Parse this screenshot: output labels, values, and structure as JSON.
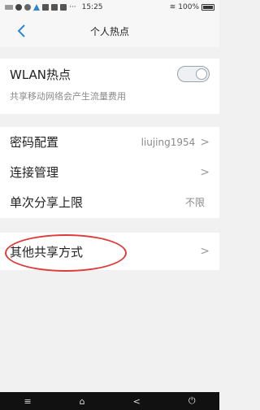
{
  "status_bar": {
    "time": "15:25",
    "more": "···",
    "battery_text": "100%"
  },
  "nav": {
    "back_icon": "chevron-left",
    "title": "个人热点"
  },
  "hotspot": {
    "label": "WLAN热点",
    "toggle_state": "off",
    "description": "共享移动网络会产生流量费用"
  },
  "settings": [
    {
      "label": "密码配置",
      "value": "liujing1954",
      "chevron": ">"
    },
    {
      "label": "连接管理",
      "value": "",
      "chevron": ">"
    },
    {
      "label": "单次分享上限",
      "value": "不限",
      "chevron": ""
    }
  ],
  "other": {
    "label": "其他共享方式",
    "chevron": ">"
  },
  "bottom_nav": {
    "menu": "≡",
    "home": "⌂",
    "back": "<",
    "power": "⏻"
  },
  "colors": {
    "accent": "#2a87d0",
    "highlight": "#e03a3a"
  }
}
